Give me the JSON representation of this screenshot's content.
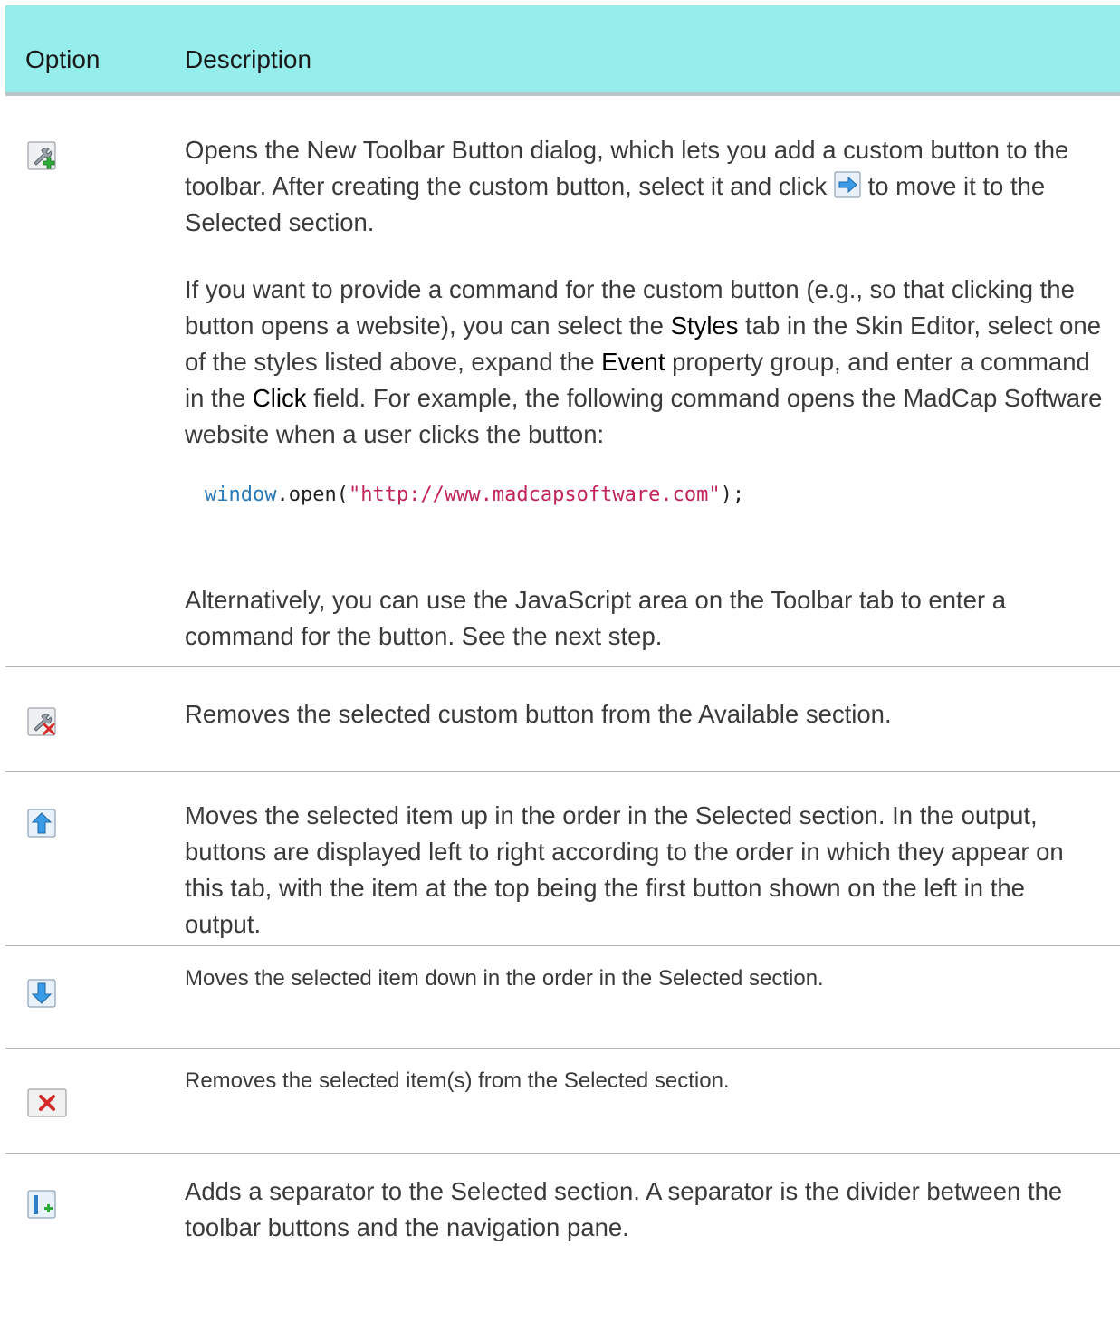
{
  "header": {
    "option": "Option",
    "description": "Description"
  },
  "rows": [
    {
      "icon": "add-custom-button-icon",
      "paragraphs": {
        "p1_a": "Opens the New Toolbar Button dialog, which lets you add a custom button to the toolbar. After creating the custom button, select it and click",
        "p1_icon": "move-right-arrow-icon",
        "p1_b": "to move it to the Selected section.",
        "p2_a": "If you want to provide a command for the custom button (e.g., so that clicking the button opens a website), you can select the",
        "p2_styles": "Styles",
        "p2_b": "tab in the Skin Editor, select one of the styles listed above, expand the",
        "p2_event": "Event",
        "p2_c": "property group, and enter a command in the",
        "p2_click": "Click",
        "p2_d": "field. For example, the following command opens the MadCap Software website when a user clicks the button:",
        "code_obj": "window",
        "code_dot": ".open(",
        "code_str": "\"http://www.madcapsoftware.com\"",
        "code_end": ");",
        "p3": "Alternatively, you can use the JavaScript area on the Toolbar tab to enter a command for the button. See the next step."
      }
    },
    {
      "icon": "remove-custom-button-icon",
      "text": "Removes the selected custom button from the Available section."
    },
    {
      "icon": "move-up-icon",
      "text": "Moves the selected item up in the order in the Selected section. In the output, buttons are displayed left to right according to the order in which they appear on this tab, with the item at the top being the first button shown on the left in the output."
    },
    {
      "icon": "move-down-icon",
      "text": "Moves the selected item down in the order in the Selected section."
    },
    {
      "icon": "remove-item-icon",
      "text": "Removes the selected item(s) from the Selected section."
    },
    {
      "icon": "add-separator-icon",
      "text": "Adds a separator to the Selected section. A separator is the divider between the toolbar buttons and the navigation pane."
    }
  ],
  "colors": {
    "header_bg": "#95eeeb",
    "header_border": "#b8c4c7",
    "row_border": "#b4b4b4",
    "code_keyword": "#2b7ab5",
    "code_string": "#c0245a"
  }
}
